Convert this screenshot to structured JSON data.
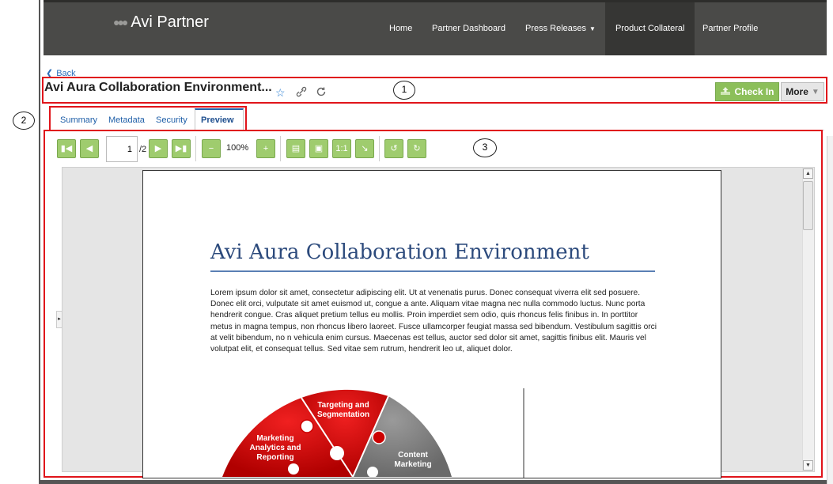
{
  "brand": {
    "name": "Avi Partner"
  },
  "nav": {
    "home": "Home",
    "partner_dashboard": "Partner Dashboard",
    "press_releases": "Press Releases",
    "product_collateral": "Product Collateral",
    "partner_profile": "Partner Profile"
  },
  "back_label": "Back",
  "document": {
    "title": "Avi Aura Collaboration Environment..."
  },
  "actions": {
    "check_in": "Check In",
    "more": "More"
  },
  "tabs": {
    "summary": "Summary",
    "metadata": "Metadata",
    "security": "Security",
    "preview": "Preview"
  },
  "callouts": {
    "one": "1",
    "two": "2",
    "three": "3"
  },
  "viewer": {
    "page_current": "1",
    "page_total": "/2",
    "zoom": "100%"
  },
  "preview_doc": {
    "heading": "Avi Aura Collaboration Environment",
    "body": "Lorem ipsum dolor sit amet, consectetur adipiscing elit. Ut at venenatis purus. Donec consequat viverra elit sed posuere. Donec elit orci, vulputate sit amet euismod ut, congue a ante. Aliquam vitae magna nec nulla commodo luctus. Nunc porta hendrerit congue. Cras aliquet pretium tellus eu mollis. Proin imperdiet sem odio, quis rhoncus felis finibus in. In porttitor metus in magna tempus, non rhoncus libero laoreet. Fusce ullamcorper feugiat massa sed bibendum. Vestibulum sagittis orci at velit bibendum, no n vehicula enim cursus. Maecenas est tellus, auctor sed dolor sit amet, sagittis finibus elit. Mauris vel volutpat elit, et consequat tellus. Sed vitae sem rutrum, hendrerit leo ut, aliquet dolor.",
    "diagram_labels": {
      "targeting": "Targeting and Segmentation",
      "marketing": "Marketing Analytics and Reporting",
      "content": "Content Marketing"
    }
  },
  "colors": {
    "nav_bg": "#4a4a48",
    "accent_green": "#8cbf5a",
    "callout_red": "#e0141a",
    "link_blue": "#1f5fa8"
  },
  "icons": [
    "people-icon",
    "chevron-left-icon",
    "star-icon",
    "link-icon",
    "refresh-icon",
    "upload-icon",
    "caret-down-icon",
    "first-page-icon",
    "prev-page-icon",
    "next-page-icon",
    "last-page-icon",
    "zoom-out-icon",
    "zoom-in-icon",
    "fit-height-icon",
    "fit-page-icon",
    "actual-size-icon",
    "fit-width-icon",
    "rotate-left-icon",
    "rotate-right-icon"
  ]
}
